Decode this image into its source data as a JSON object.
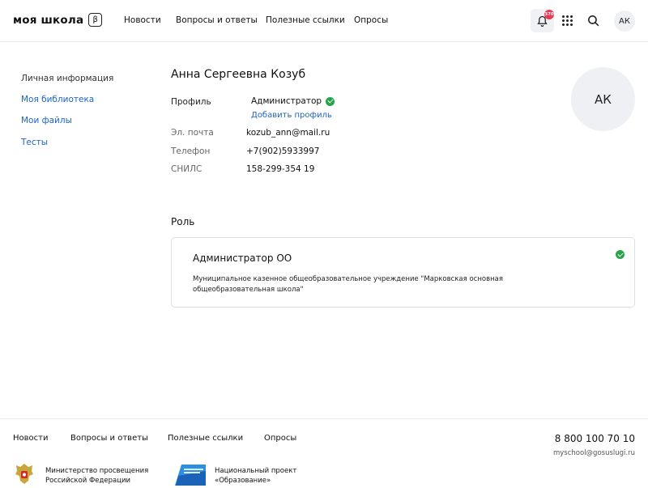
{
  "header": {
    "logo_text": "моя школа",
    "logo_badge": "β",
    "nav": [
      "Новости",
      "Вопросы и ответы",
      "Полезные ссылки",
      "Опросы"
    ],
    "notification_count": "370",
    "user_initials": "АК"
  },
  "sidebar": {
    "items": [
      {
        "label": "Личная информация",
        "active": true
      },
      {
        "label": "Моя библиотека",
        "active": false
      },
      {
        "label": "Мои файлы",
        "active": false
      },
      {
        "label": "Тесты",
        "active": false
      }
    ]
  },
  "profile": {
    "full_name": "Анна Сергеевна Козуб",
    "initials": "АК",
    "profile_label": "Профиль",
    "profile_role": "Администратор",
    "add_profile": "Добавить профиль",
    "fields": [
      {
        "label": "Эл. почта",
        "value": "kozub_ann@mail.ru"
      },
      {
        "label": "Телефон",
        "value": "+7(902)5933997"
      },
      {
        "label": "СНИЛС",
        "value": "158-299-354 19"
      }
    ]
  },
  "role": {
    "heading": "Роль",
    "title": "Администратор ОО",
    "description": "Муниципальное казенное общеобразовательное учреждение \"Марковская основная общеобразовательная школа\""
  },
  "footer": {
    "nav": [
      "Новости",
      "Вопросы и ответы",
      "Полезные ссылки",
      "Опросы"
    ],
    "phone": "8 800 100 70 10",
    "email": "myschool@gosuslugi.ru",
    "org1_line1": "Министерство просвещения",
    "org1_line2": "Российской Федерации",
    "org2_line1": "Национальный проект",
    "org2_line2": "«Образование»"
  },
  "colors": {
    "link": "#1e63c6",
    "success": "#27a34a",
    "badge": "#e73a54"
  }
}
